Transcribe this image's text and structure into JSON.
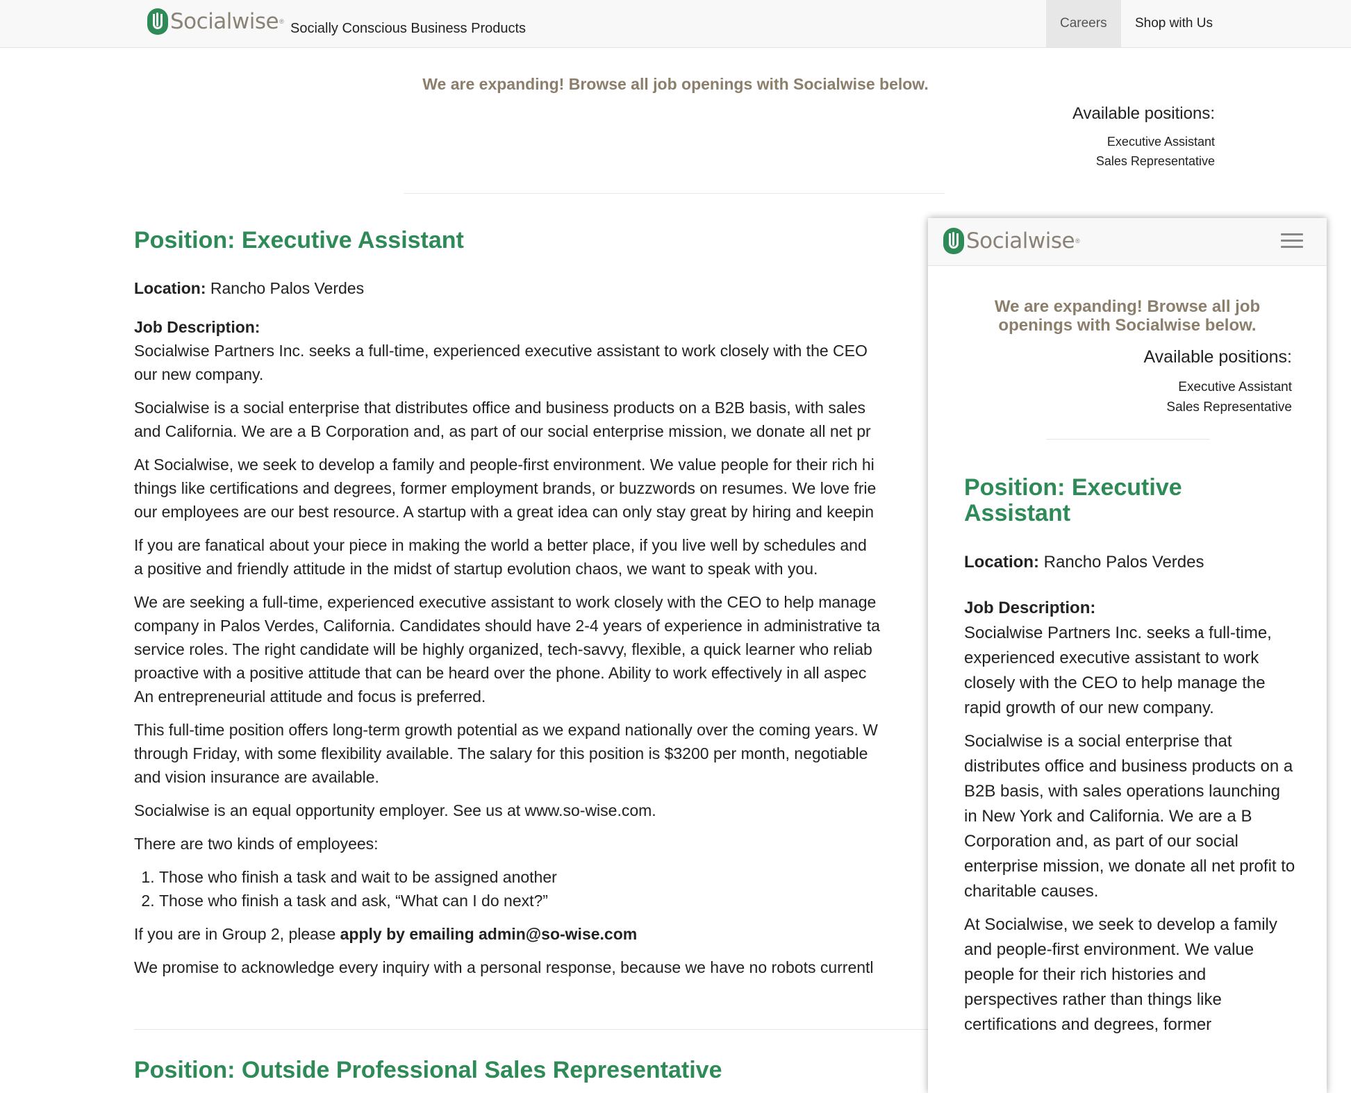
{
  "navbar": {
    "brand": "Socialwise",
    "brand_mark": "®",
    "tagline": "Socially Conscious Business Products",
    "links": [
      "Careers",
      "Shop with Us"
    ],
    "active_link": "Careers"
  },
  "intro": {
    "expanding": "We are expanding! Browse all job openings with Socialwise below.",
    "available_title": "Available positions:",
    "positions": [
      "Executive Assistant",
      "Sales Representative"
    ]
  },
  "job": {
    "title": "Position: Executive Assistant",
    "location_label": "Location:",
    "location": "Rancho Palos Verdes",
    "desc_label": "Job Description:",
    "paragraphs": [
      "Socialwise Partners Inc. seeks a full-time, experienced executive assistant to work closely with the CEO",
      "our new company.",
      "Socialwise is a social enterprise that distributes office and business products on a B2B basis, with sales",
      "and California. We are a B Corporation and, as part of our social enterprise mission, we donate all net pr",
      "At Socialwise, we seek to develop a family and people-first environment. We value people for their rich hi",
      "things like certifications and degrees, former employment brands, or buzzwords on resumes. We love frie",
      "our employees are our best resource. A startup with a great idea can only stay great by hiring and keepin",
      "If you are fanatical about your piece in making the world a better place, if you live well by schedules and",
      "a positive and friendly attitude in the midst of startup evolution chaos, we want to speak with you.",
      "We are seeking a full-time, experienced executive assistant to work closely with the CEO to help manage",
      "company in Palos Verdes, California. Candidates should have 2-4 years of experience in administrative ta",
      "service roles. The right candidate will be highly organized, tech-savvy, flexible, a quick learner who reliab",
      "proactive with a positive attitude that can be heard over the phone. Ability to work effectively in all aspec",
      "An entrepreneurial attitude and focus is preferred.",
      "This full-time position offers long-term growth potential as we expand nationally over the coming years. W",
      "through Friday, with some flexibility available. The salary for this position is $3200 per month, negotiable",
      "and vision insurance are available.",
      "Socialwise is an equal opportunity employer. See us at www.so-wise.com.",
      "There are two kinds of employees:"
    ],
    "list": [
      "Those who finish a task and wait to be assigned another",
      "Those who finish a task and ask, “What can I do next?”"
    ],
    "apply_prefix": "If you are in Group 2, please",
    "apply_bold": "apply by emailing admin@so-wise.com",
    "closing": "We promise to acknowledge every inquiry with a personal response, because we have no robots currentl",
    "next_title": "Position: Outside Professional Sales Representative"
  },
  "mobile": {
    "expanding_lines": [
      "We are expanding! Browse all job",
      "openings with Socialwise below."
    ],
    "title_lines": [
      "Position: Executive",
      "Assistant"
    ],
    "para1": "Socialwise Partners Inc. seeks a full-time, experienced executive assistant to work closely with the CEO to help manage the rapid growth of our new company.",
    "para2": "Socialwise is a social enterprise that distributes office and business products on a B2B basis, with sales operations launching in New York and California. We are a B Corporation and, as part of our social enterprise mission, we donate all net profit to charitable causes.",
    "para3": "At Socialwise, we seek to develop a family and people-first environment. We value people for their rich histories and perspectives rather than things like certifications and degrees, former"
  },
  "colors": {
    "brand_green": "#2e8b57",
    "taupe": "#8b7e6a",
    "nav_bg": "#f8f8f8",
    "nav_active": "#e7e7e7"
  },
  "icons": [
    "logo-icon",
    "hamburger-menu-icon"
  ]
}
